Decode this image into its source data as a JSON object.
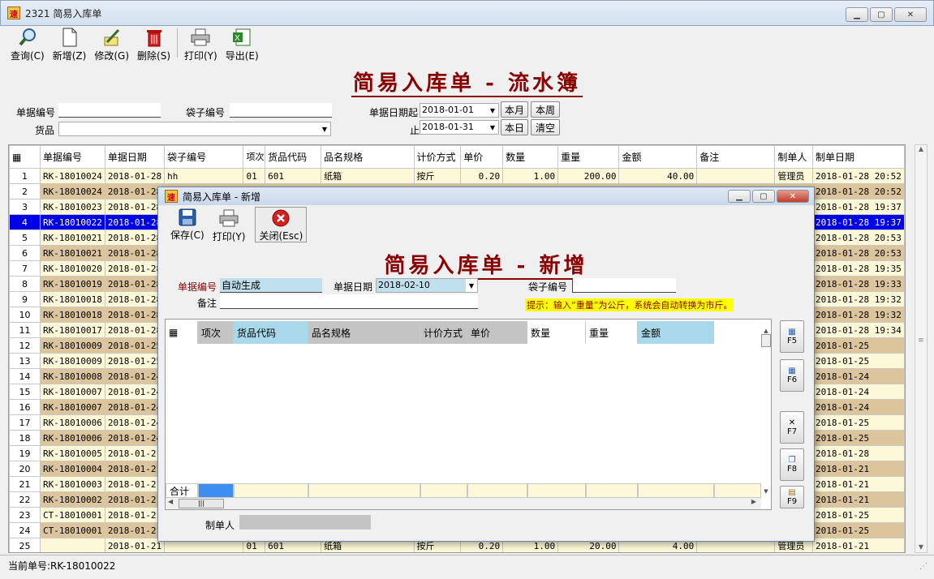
{
  "window": {
    "title": "2321 简易入库单",
    "app_icon_text": "速"
  },
  "toolbar": [
    {
      "label": "查询(C)",
      "icon": "search-icon"
    },
    {
      "label": "新增(Z)",
      "icon": "new-doc-icon"
    },
    {
      "label": "修改(G)",
      "icon": "edit-icon"
    },
    {
      "label": "删除(S)",
      "icon": "trash-icon"
    },
    {
      "label": "打印(Y)",
      "icon": "printer-icon"
    },
    {
      "label": "导出(E)",
      "icon": "excel-icon"
    }
  ],
  "page_title": "简易入库单 - 流水簿",
  "filters": {
    "doc_no_label": "单据编号",
    "doc_no_value": "",
    "bag_no_label": "袋子编号",
    "bag_no_value": "",
    "goods_label": "货品",
    "goods_value": "",
    "date_from_label": "单据日期起",
    "date_from": "2018-01-01",
    "date_to_label": "止",
    "date_to": "2018-01-31",
    "btn_month": "本月",
    "btn_week": "本周",
    "btn_today": "本日",
    "btn_clear": "清空"
  },
  "grid": {
    "columns": [
      "单据编号",
      "单据日期",
      "袋子编号",
      "项次",
      "货品代码",
      "品名规格",
      "计价方式",
      "单价",
      "数量",
      "重量",
      "金额",
      "备注",
      "制单人",
      "制单日期"
    ],
    "rows": [
      {
        "n": "1",
        "no": "RK-18010024",
        "date": "2018-01-28",
        "bag": "hh",
        "item": "01",
        "code": "601",
        "name": "纸箱",
        "price_mode": "按斤",
        "price": "0.20",
        "qty": "1.00",
        "weight": "200.00",
        "amount": "40.00",
        "note": "",
        "maker": "管理员",
        "made": "2018-01-28 20:52"
      },
      {
        "n": "2",
        "no": "RK-18010024",
        "date": "2018-01-28",
        "bag": "",
        "item": "",
        "code": "",
        "name": "",
        "price_mode": "",
        "price": "",
        "qty": "",
        "weight": "",
        "amount": "",
        "note": "",
        "maker": "",
        "made": "2018-01-28 20:52"
      },
      {
        "n": "3",
        "no": "RK-18010023",
        "date": "2018-01-28",
        "bag": "",
        "item": "",
        "code": "",
        "name": "",
        "price_mode": "",
        "price": "",
        "qty": "",
        "weight": "",
        "amount": "",
        "note": "",
        "maker": "",
        "made": "2018-01-28 19:37"
      },
      {
        "n": "4",
        "no": "RK-18010022",
        "date": "2018-01-28",
        "bag": "",
        "item": "",
        "code": "",
        "name": "",
        "price_mode": "",
        "price": "",
        "qty": "",
        "weight": "",
        "amount": "",
        "note": "",
        "maker": "",
        "made": "2018-01-28 19:37"
      },
      {
        "n": "5",
        "no": "RK-18010021",
        "date": "2018-01-28",
        "bag": "",
        "item": "",
        "code": "",
        "name": "",
        "price_mode": "",
        "price": "",
        "qty": "",
        "weight": "",
        "amount": "",
        "note": "",
        "maker": "",
        "made": "2018-01-28 20:53"
      },
      {
        "n": "6",
        "no": "RK-18010021",
        "date": "2018-01-28",
        "bag": "",
        "item": "",
        "code": "",
        "name": "",
        "price_mode": "",
        "price": "",
        "qty": "",
        "weight": "",
        "amount": "",
        "note": "",
        "maker": "",
        "made": "2018-01-28 20:53"
      },
      {
        "n": "7",
        "no": "RK-18010020",
        "date": "2018-01-28",
        "bag": "",
        "item": "",
        "code": "",
        "name": "",
        "price_mode": "",
        "price": "",
        "qty": "",
        "weight": "",
        "amount": "",
        "note": "",
        "maker": "",
        "made": "2018-01-28 19:35"
      },
      {
        "n": "8",
        "no": "RK-18010019",
        "date": "2018-01-28",
        "bag": "",
        "item": "",
        "code": "",
        "name": "",
        "price_mode": "",
        "price": "",
        "qty": "",
        "weight": "",
        "amount": "",
        "note": "",
        "maker": "",
        "made": "2018-01-28 19:33"
      },
      {
        "n": "9",
        "no": "RK-18010018",
        "date": "2018-01-28",
        "bag": "",
        "item": "",
        "code": "",
        "name": "",
        "price_mode": "",
        "price": "",
        "qty": "",
        "weight": "",
        "amount": "",
        "note": "",
        "maker": "",
        "made": "2018-01-28 19:32"
      },
      {
        "n": "10",
        "no": "RK-18010018",
        "date": "2018-01-28",
        "bag": "",
        "item": "",
        "code": "",
        "name": "",
        "price_mode": "",
        "price": "",
        "qty": "",
        "weight": "",
        "amount": "",
        "note": "",
        "maker": "",
        "made": "2018-01-28 19:32"
      },
      {
        "n": "11",
        "no": "RK-18010017",
        "date": "2018-01-28",
        "bag": "",
        "item": "",
        "code": "",
        "name": "",
        "price_mode": "",
        "price": "",
        "qty": "",
        "weight": "",
        "amount": "",
        "note": "",
        "maker": "",
        "made": "2018-01-28 19:34"
      },
      {
        "n": "12",
        "no": "RK-18010009",
        "date": "2018-01-25",
        "bag": "",
        "item": "",
        "code": "",
        "name": "",
        "price_mode": "",
        "price": "",
        "qty": "",
        "weight": "",
        "amount": "",
        "note": "",
        "maker": "",
        "made": "2018-01-25"
      },
      {
        "n": "13",
        "no": "RK-18010009",
        "date": "2018-01-25",
        "bag": "",
        "item": "",
        "code": "",
        "name": "",
        "price_mode": "",
        "price": "",
        "qty": "",
        "weight": "",
        "amount": "",
        "note": "",
        "maker": "",
        "made": "2018-01-25"
      },
      {
        "n": "14",
        "no": "RK-18010008",
        "date": "2018-01-24",
        "bag": "",
        "item": "",
        "code": "",
        "name": "",
        "price_mode": "",
        "price": "",
        "qty": "",
        "weight": "",
        "amount": "",
        "note": "",
        "maker": "",
        "made": "2018-01-24"
      },
      {
        "n": "15",
        "no": "RK-18010007",
        "date": "2018-01-24",
        "bag": "",
        "item": "",
        "code": "",
        "name": "",
        "price_mode": "",
        "price": "",
        "qty": "",
        "weight": "",
        "amount": "",
        "note": "",
        "maker": "",
        "made": "2018-01-24"
      },
      {
        "n": "16",
        "no": "RK-18010007",
        "date": "2018-01-24",
        "bag": "",
        "item": "",
        "code": "",
        "name": "",
        "price_mode": "",
        "price": "",
        "qty": "",
        "weight": "",
        "amount": "",
        "note": "",
        "maker": "",
        "made": "2018-01-24"
      },
      {
        "n": "17",
        "no": "RK-18010006",
        "date": "2018-01-24",
        "bag": "",
        "item": "",
        "code": "",
        "name": "",
        "price_mode": "",
        "price": "",
        "qty": "",
        "weight": "",
        "amount": "",
        "note": "",
        "maker": "",
        "made": "2018-01-25"
      },
      {
        "n": "18",
        "no": "RK-18010006",
        "date": "2018-01-24",
        "bag": "",
        "item": "",
        "code": "",
        "name": "",
        "price_mode": "",
        "price": "",
        "qty": "",
        "weight": "",
        "amount": "",
        "note": "",
        "maker": "",
        "made": "2018-01-25"
      },
      {
        "n": "19",
        "no": "RK-18010005",
        "date": "2018-01-21",
        "bag": "",
        "item": "",
        "code": "",
        "name": "",
        "price_mode": "",
        "price": "",
        "qty": "",
        "weight": "",
        "amount": "",
        "note": "",
        "maker": "",
        "made": "2018-01-28"
      },
      {
        "n": "20",
        "no": "RK-18010004",
        "date": "2018-01-21",
        "bag": "",
        "item": "",
        "code": "",
        "name": "",
        "price_mode": "",
        "price": "",
        "qty": "",
        "weight": "",
        "amount": "",
        "note": "",
        "maker": "",
        "made": "2018-01-21"
      },
      {
        "n": "21",
        "no": "RK-18010003",
        "date": "2018-01-21",
        "bag": "",
        "item": "",
        "code": "",
        "name": "",
        "price_mode": "",
        "price": "",
        "qty": "",
        "weight": "",
        "amount": "",
        "note": "",
        "maker": "",
        "made": "2018-01-21"
      },
      {
        "n": "22",
        "no": "RK-18010002",
        "date": "2018-01-21",
        "bag": "",
        "item": "",
        "code": "",
        "name": "",
        "price_mode": "",
        "price": "",
        "qty": "",
        "weight": "",
        "amount": "",
        "note": "",
        "maker": "",
        "made": "2018-01-21"
      },
      {
        "n": "23",
        "no": "CT-18010001",
        "date": "2018-01-21",
        "bag": "",
        "item": "",
        "code": "",
        "name": "",
        "price_mode": "",
        "price": "",
        "qty": "",
        "weight": "",
        "amount": "",
        "note": "",
        "maker": "",
        "made": "2018-01-25"
      },
      {
        "n": "24",
        "no": "CT-18010001",
        "date": "2018-01-21",
        "bag": "",
        "item": "",
        "code": "",
        "name": "",
        "price_mode": "",
        "price": "",
        "qty": "",
        "weight": "",
        "amount": "",
        "note": "",
        "maker": "",
        "made": "2018-01-25"
      },
      {
        "n": "25",
        "no": "",
        "date": "2018-01-21",
        "bag": "",
        "item": "01",
        "code": "601",
        "name": "纸箱",
        "price_mode": "按斤",
        "price": "0.20",
        "qty": "1.00",
        "weight": "20.00",
        "amount": "4.00",
        "note": "",
        "maker": "管理员",
        "made": "2018-01-21"
      }
    ],
    "selected_row": "4"
  },
  "status": {
    "text": "当前单号:RK-18010022"
  },
  "dialog": {
    "title": "简易入库单 - 新增",
    "toolbar": [
      {
        "label": "保存(C)",
        "icon": "save-icon"
      },
      {
        "label": "打印(Y)",
        "icon": "printer-icon"
      },
      {
        "label": "关闭(Esc)",
        "icon": "close-circle-icon"
      }
    ],
    "heading": "简易入库单 - 新增",
    "doc_no_label": "单据编号",
    "doc_no_value": "自动生成",
    "doc_date_label": "单据日期",
    "doc_date_value": "2018-02-10",
    "bag_no_label": "袋子编号",
    "bag_no_value": "",
    "note_label": "备注",
    "note_value": "",
    "hint": "提示：输入“重量”为公斤，系统会自动转换为市斤。",
    "grid_columns": [
      "项次",
      "货品代码",
      "品名规格",
      "计价方式",
      "单价",
      "数量",
      "重量",
      "金额"
    ],
    "total_label": "合计",
    "maker_label": "制单人",
    "maker_value": "",
    "fkeys": [
      "F5",
      "F6",
      "F7",
      "F8",
      "F9"
    ]
  }
}
